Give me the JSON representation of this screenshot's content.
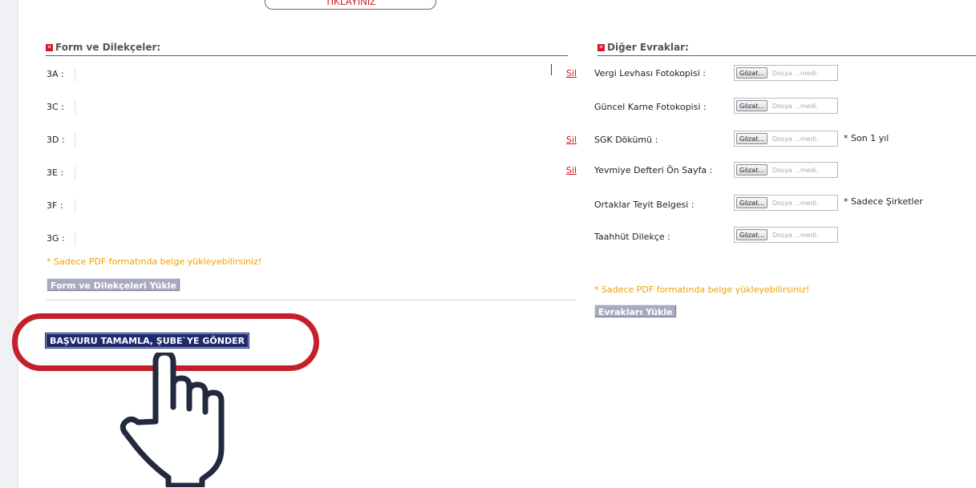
{
  "top_button": {
    "label": "TIKLAYINIZ"
  },
  "left_section": {
    "title": "Form ve Dilekçeler:",
    "fields": [
      {
        "label": "3A :"
      },
      {
        "label": "3C :"
      },
      {
        "label": "3D :"
      },
      {
        "label": "3E :"
      },
      {
        "label": "3F :"
      },
      {
        "label": "3G :"
      }
    ],
    "note": "* Sadece PDF formatında belge yükleyebilirsiniz!",
    "upload_button": "Form ve Dilekçeleri Yükle",
    "submit_button": "BAŞVURU TAMAMLA, ŞUBE`YE GÖNDER"
  },
  "right_section": {
    "title": "Diğer Evraklar:",
    "browse_label": "Gözat...",
    "file_placeholder": "Dosya ...medi.",
    "delete_label": "Sil",
    "documents": [
      {
        "label": "Vergi Levhası Fotokopisi :",
        "extra": ""
      },
      {
        "label": "Güncel Karne Fotokopisi :",
        "extra": ""
      },
      {
        "label": "SGK Dökümü :",
        "extra": "* Son 1 yıl"
      },
      {
        "label": "Yevmiye Defteri Ön Sayfa :",
        "extra": ""
      },
      {
        "label": "Ortaklar Teyit Belgesi :",
        "extra": "* Sadece Şirketler"
      },
      {
        "label": "Taahhüt Dilekçe :",
        "extra": ""
      }
    ],
    "note": "* Sadece PDF formatında belge yükleyebilirsiniz!",
    "upload_button": "Evrakları Yükle"
  },
  "colors": {
    "accent_red": "#c4202a",
    "button_navy": "#1f2a6e",
    "note_orange": "#f0a000",
    "button_gray": "#a7aac0"
  },
  "icons": {
    "highlight": "red-oval-highlight",
    "pointer": "hand-pointer-icon"
  }
}
